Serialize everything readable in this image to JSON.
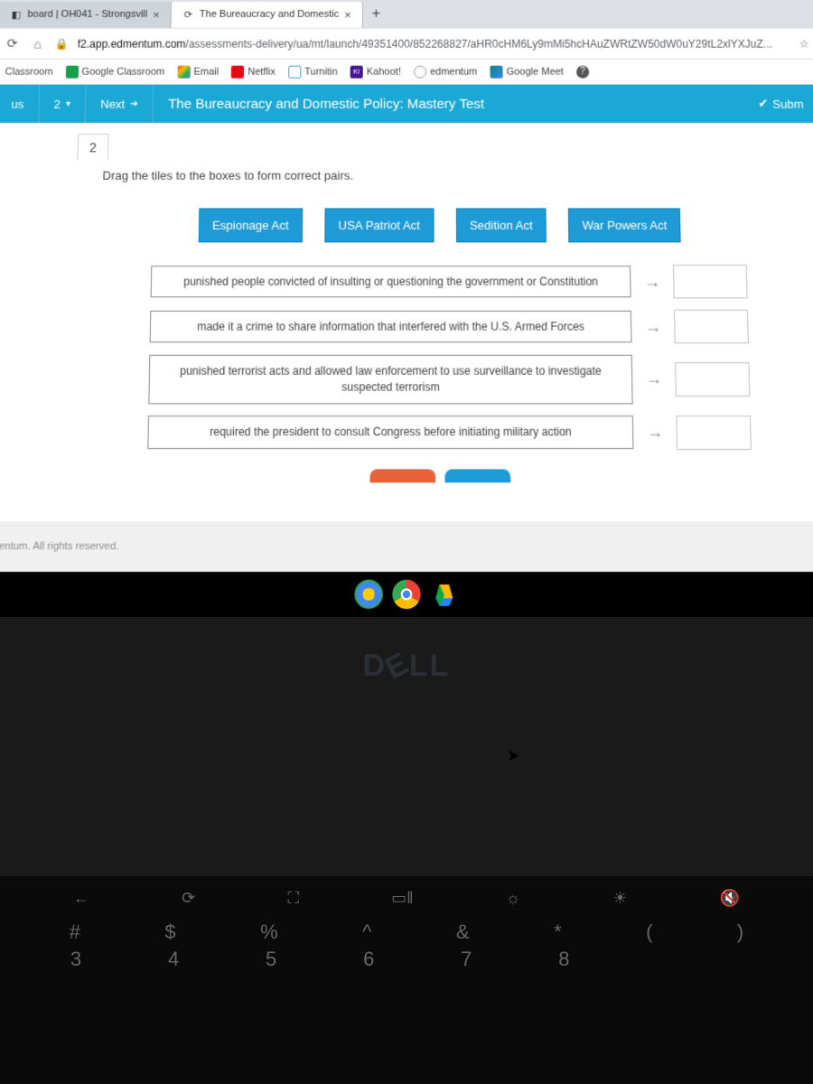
{
  "tabs": [
    {
      "title": "board | OH041 - Strongsvill",
      "active": false
    },
    {
      "title": "The Bureaucracy and Domestic",
      "active": true
    }
  ],
  "url": {
    "host": "f2.app.edmentum.com",
    "path": "/assessments-delivery/ua/mt/launch/49351400/852268827/aHR0cHM6Ly9mMi5hcHAuZWRtZW50dW0uY29tL2xlYXJuZ..."
  },
  "bookmarks": [
    "Classroom",
    "Google Classroom",
    "Email",
    "Netflix",
    "Turnitin",
    "Kahoot!",
    "edmentum",
    "Google Meet"
  ],
  "appbar": {
    "prev": "us",
    "counter": "2",
    "next": "Next",
    "title": "The Bureaucracy and Domestic Policy: Mastery Test",
    "submit": "Subm"
  },
  "question": {
    "number": "2",
    "prompt": "Drag the tiles to the boxes to form correct pairs.",
    "tiles": [
      "Espionage Act",
      "USA Patriot Act",
      "Sedition Act",
      "War Powers Act"
    ],
    "descriptions": [
      "punished people convicted of insulting or questioning the government or Constitution",
      "made it a crime to share information that interfered with the U.S. Armed Forces",
      "punished terrorist acts and allowed law enforcement to use surveillance to investigate suspected terrorism",
      "required the president to consult Congress before initiating military action"
    ]
  },
  "footer": "mentum. All rights reserved.",
  "dell": "D∈LL",
  "chart_data": null
}
